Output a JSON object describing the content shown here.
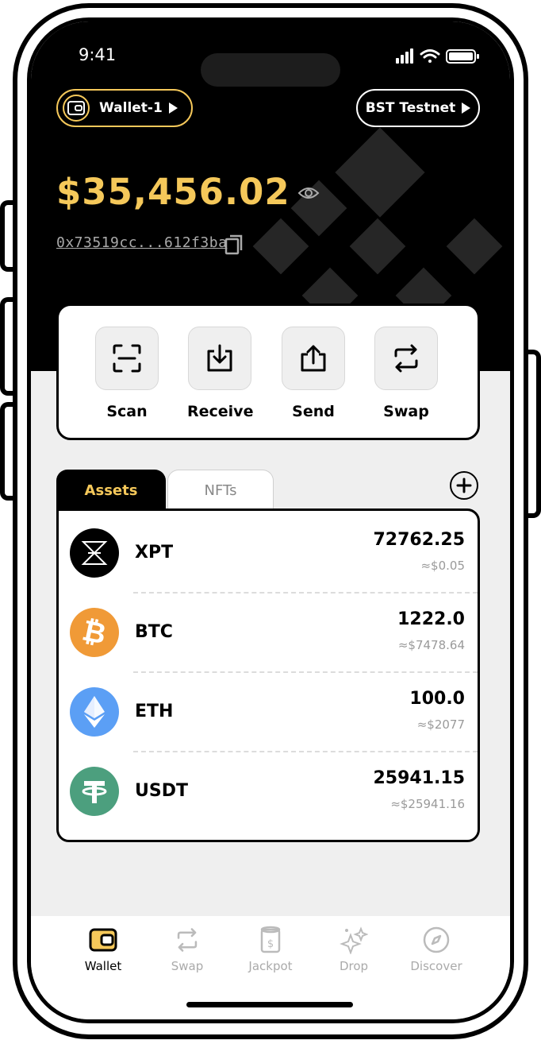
{
  "status_bar": {
    "time": "9:41"
  },
  "header": {
    "wallet_name": "Wallet-1",
    "network": "BST Testnet",
    "balance": "$35,456.02",
    "address": "0x73519cc...612f3ba"
  },
  "actions": [
    {
      "label": "Scan",
      "icon": "scan-icon"
    },
    {
      "label": "Receive",
      "icon": "receive-icon"
    },
    {
      "label": "Send",
      "icon": "send-icon"
    },
    {
      "label": "Swap",
      "icon": "swap-icon"
    }
  ],
  "tabs": {
    "assets": "Assets",
    "nfts": "NFTs",
    "active": "Assets"
  },
  "assets": [
    {
      "symbol": "XPT",
      "amount": "72762.25",
      "usd": "≈$0.05",
      "color": "#000000"
    },
    {
      "symbol": "BTC",
      "amount": "1222.0",
      "usd": "≈$7478.64",
      "color": "#f09a37"
    },
    {
      "symbol": "ETH",
      "amount": "100.0",
      "usd": "≈$2077",
      "color": "#5b9ff5"
    },
    {
      "symbol": "USDT",
      "amount": "25941.15",
      "usd": "≈$25941.16",
      "color": "#4c9f7e"
    }
  ],
  "nav": [
    {
      "label": "Wallet",
      "icon": "wallet-icon",
      "active": true
    },
    {
      "label": "Swap",
      "icon": "swap-icon",
      "active": false
    },
    {
      "label": "Jackpot",
      "icon": "jackpot-icon",
      "active": false
    },
    {
      "label": "Drop",
      "icon": "drop-sparkle-icon",
      "active": false
    },
    {
      "label": "Discover",
      "icon": "compass-icon",
      "active": false
    }
  ],
  "colors": {
    "accent": "#f5c85a",
    "background": "#000000",
    "panel": "#efefef"
  }
}
